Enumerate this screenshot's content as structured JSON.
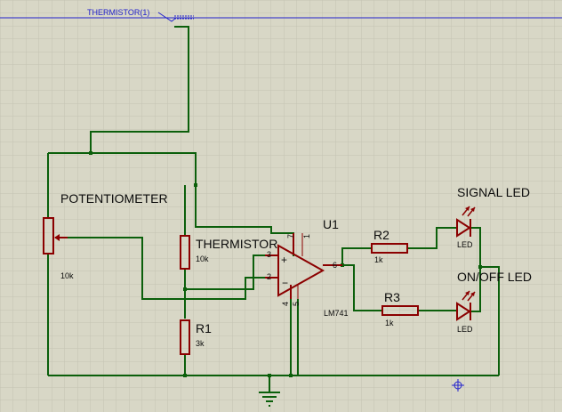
{
  "probe": {
    "label": "THERMISTOR(1)"
  },
  "components": {
    "potentiometer": {
      "name": "POTENTIOMETER",
      "value": "10k"
    },
    "thermistor": {
      "name": "THERMISTOR",
      "value": "10k"
    },
    "r1": {
      "name": "R1",
      "value": "3k"
    },
    "opamp": {
      "ref": "U1",
      "part": "LM741",
      "pins": {
        "p2": "2",
        "p3": "3",
        "p4": "4",
        "p5": "5",
        "p6": "6",
        "p7": "7",
        "p1": "1"
      }
    },
    "r2": {
      "name": "R2",
      "value": "1k"
    },
    "r3": {
      "name": "R3",
      "value": "1k"
    },
    "led_signal": {
      "name": "SIGNAL LED",
      "type": "LED"
    },
    "led_onoff": {
      "name": "ON/OFF LED",
      "type": "LED"
    }
  },
  "colors": {
    "wire": "#0b5f0b",
    "component": "#8b0000",
    "grid": "#c4c3b3",
    "background": "#d8d7c6",
    "probe": "#2222cc"
  }
}
